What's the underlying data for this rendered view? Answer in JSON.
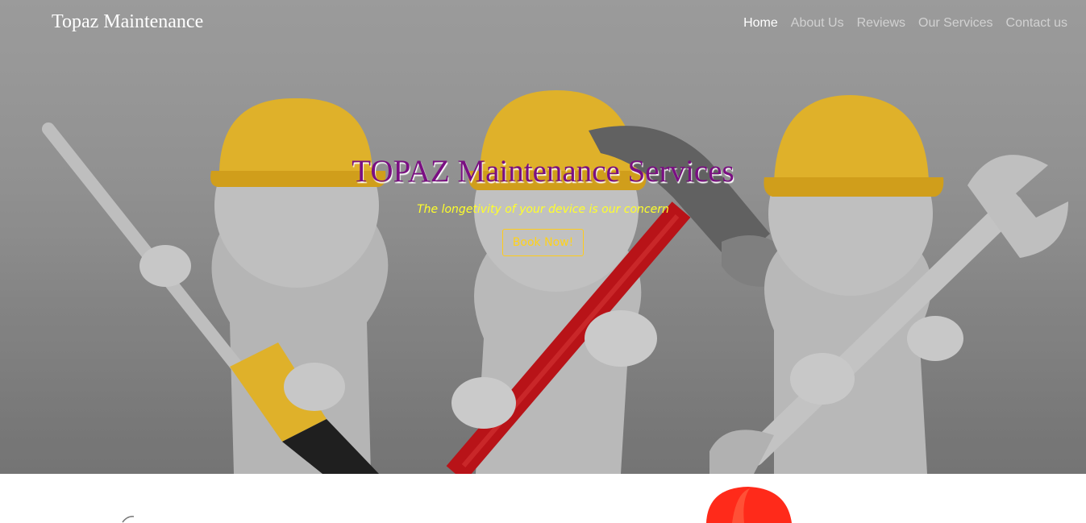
{
  "navbar": {
    "brand": "Topaz Maintenance",
    "links": [
      {
        "label": "Home",
        "active": true
      },
      {
        "label": "About Us",
        "active": false
      },
      {
        "label": "Reviews",
        "active": false
      },
      {
        "label": "Our Services",
        "active": false
      },
      {
        "label": "Contact us",
        "active": false
      }
    ]
  },
  "hero": {
    "title": "TOPAZ Maintenance Services",
    "tagline": "The longetivity of your device is our concern",
    "cta_label": "Book Now!",
    "image_subject": "three-workers-with-tools-illustration"
  },
  "colors": {
    "title": "#7a0f82",
    "tagline": "#ffff2a",
    "cta": "#ffcc1a",
    "helmet": "#f2c12e",
    "hammer_handle": "#c8151b",
    "below_helmet": "#ff2a1a"
  }
}
